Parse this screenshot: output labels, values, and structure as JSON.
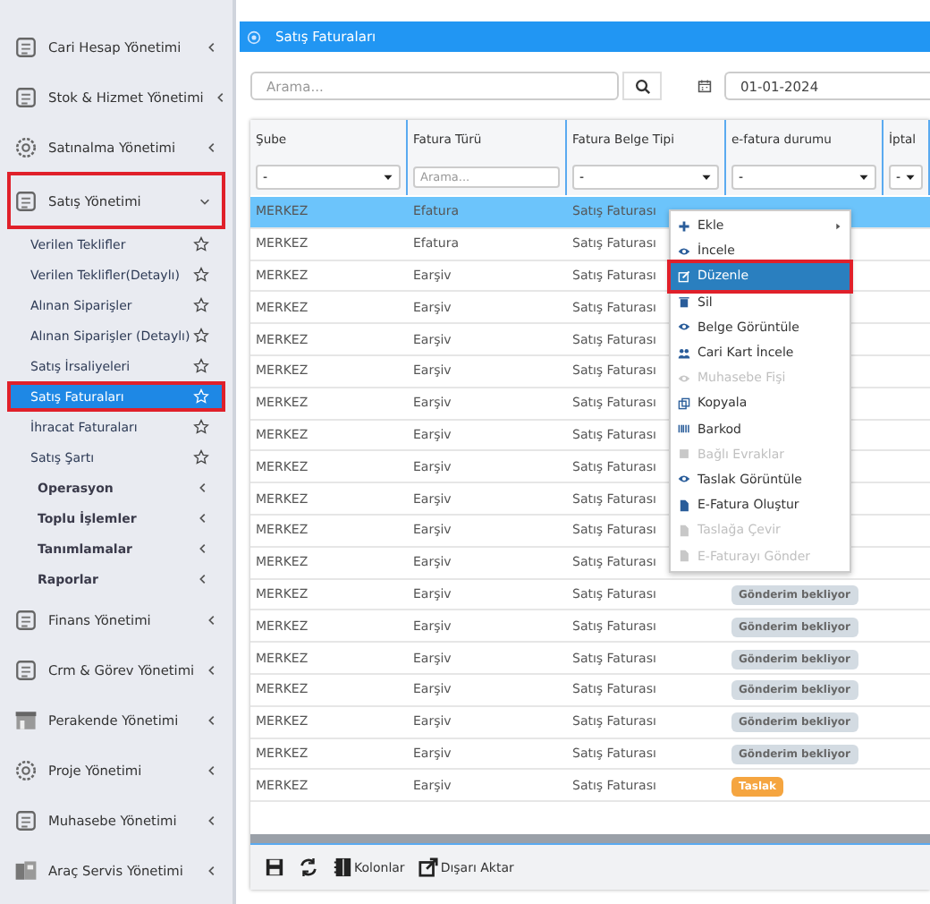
{
  "sidebar": {
    "items": [
      {
        "label": "Cari Hesap Yönetimi",
        "expanded": false,
        "annotated": false
      },
      {
        "label": "Stok & Hizmet Yönetimi",
        "expanded": false,
        "annotated": false
      },
      {
        "label": "Satınalma Yönetimi",
        "expanded": false,
        "annotated": false
      },
      {
        "label": "Satış Yönetimi",
        "expanded": true,
        "annotated": true,
        "children": [
          {
            "label": "Verilen Teklifler",
            "kind": "page",
            "selected": false,
            "annotated": false
          },
          {
            "label": "Verilen Teklifler(Detaylı)",
            "kind": "page",
            "selected": false,
            "annotated": false
          },
          {
            "label": "Alınan Siparişler",
            "kind": "page",
            "selected": false,
            "annotated": false
          },
          {
            "label": "Alınan Siparişler (Detaylı)",
            "kind": "page",
            "selected": false,
            "annotated": false
          },
          {
            "label": "Satış İrsaliyeleri",
            "kind": "page",
            "selected": false,
            "annotated": false
          },
          {
            "label": "Satış Faturaları",
            "kind": "page",
            "selected": true,
            "annotated": true
          },
          {
            "label": "İhracat Faturaları",
            "kind": "page",
            "selected": false,
            "annotated": false
          },
          {
            "label": "Satış Şartı",
            "kind": "page",
            "selected": false,
            "annotated": false
          },
          {
            "label": "Operasyon",
            "kind": "group",
            "selected": false,
            "annotated": false
          },
          {
            "label": "Toplu İşlemler",
            "kind": "group",
            "selected": false,
            "annotated": false
          },
          {
            "label": "Tanımlamalar",
            "kind": "group",
            "selected": false,
            "annotated": false
          },
          {
            "label": "Raporlar",
            "kind": "group",
            "selected": false,
            "annotated": false
          }
        ]
      },
      {
        "label": "Finans Yönetimi",
        "expanded": false,
        "annotated": false
      },
      {
        "label": "Crm & Görev Yönetimi",
        "expanded": false,
        "annotated": false
      },
      {
        "label": "Perakende Yönetimi",
        "expanded": false,
        "annotated": false
      },
      {
        "label": "Proje Yönetimi",
        "expanded": false,
        "annotated": false
      },
      {
        "label": "Muhasebe Yönetimi",
        "expanded": false,
        "annotated": false
      },
      {
        "label": "Araç Servis Yönetimi",
        "expanded": false,
        "annotated": false
      }
    ]
  },
  "panel": {
    "title": "Satış Faturaları"
  },
  "search": {
    "placeholder": "Arama..."
  },
  "date": {
    "value": "01-01-2024"
  },
  "table": {
    "columns": [
      {
        "label": "Şube",
        "kind": "select",
        "filter_value": "-"
      },
      {
        "label": "Fatura Türü",
        "kind": "text",
        "placeholder": "Arama..."
      },
      {
        "label": "Fatura Belge Tipi",
        "kind": "select",
        "filter_value": "-"
      },
      {
        "label": "e-fatura durumu",
        "kind": "select",
        "filter_value": "-"
      },
      {
        "label": "İptal",
        "kind": "select",
        "filter_value": "-"
      }
    ],
    "rows": [
      {
        "cells": [
          "MERKEZ",
          "Efatura",
          "Satış Faturası"
        ],
        "selected": true
      },
      {
        "cells": [
          "MERKEZ",
          "Efatura",
          "Satış Faturası"
        ],
        "selected": false
      },
      {
        "cells": [
          "MERKEZ",
          "Earşiv",
          "Satış Faturası"
        ],
        "selected": false
      },
      {
        "cells": [
          "MERKEZ",
          "Earşiv",
          "Satış Faturası"
        ],
        "selected": false
      },
      {
        "cells": [
          "MERKEZ",
          "Earşiv",
          "Satış Faturası"
        ],
        "selected": false
      },
      {
        "cells": [
          "MERKEZ",
          "Earşiv",
          "Satış Faturası"
        ],
        "selected": false
      },
      {
        "cells": [
          "MERKEZ",
          "Earşiv",
          "Satış Faturası"
        ],
        "selected": false
      },
      {
        "cells": [
          "MERKEZ",
          "Earşiv",
          "Satış Faturası"
        ],
        "selected": false
      },
      {
        "cells": [
          "MERKEZ",
          "Earşiv",
          "Satış Faturası"
        ],
        "selected": false
      },
      {
        "cells": [
          "MERKEZ",
          "Earşiv",
          "Satış Faturası"
        ],
        "selected": false
      },
      {
        "cells": [
          "MERKEZ",
          "Earşiv",
          "Satış Faturası"
        ],
        "selected": false
      },
      {
        "cells": [
          "MERKEZ",
          "Earşiv",
          "Satış Faturası"
        ],
        "selected": false
      },
      {
        "cells": [
          "MERKEZ",
          "Earşiv",
          "Satış Faturası"
        ],
        "status": {
          "label": "Gönderim bekliyor",
          "color": "#d3dbe2"
        },
        "selected": false
      },
      {
        "cells": [
          "MERKEZ",
          "Earşiv",
          "Satış Faturası"
        ],
        "status": {
          "label": "Gönderim bekliyor",
          "color": "#d3dbe2"
        },
        "selected": false
      },
      {
        "cells": [
          "MERKEZ",
          "Earşiv",
          "Satış Faturası"
        ],
        "status": {
          "label": "Gönderim bekliyor",
          "color": "#d3dbe2"
        },
        "selected": false
      },
      {
        "cells": [
          "MERKEZ",
          "Earşiv",
          "Satış Faturası"
        ],
        "status": {
          "label": "Gönderim bekliyor",
          "color": "#d3dbe2"
        },
        "selected": false
      },
      {
        "cells": [
          "MERKEZ",
          "Earşiv",
          "Satış Faturası"
        ],
        "status": {
          "label": "Gönderim bekliyor",
          "color": "#d3dbe2"
        },
        "selected": false
      },
      {
        "cells": [
          "MERKEZ",
          "Earşiv",
          "Satış Faturası"
        ],
        "status": {
          "label": "Gönderim bekliyor",
          "color": "#d3dbe2"
        },
        "selected": false
      },
      {
        "cells": [
          "MERKEZ",
          "Earşiv",
          "Satış Faturası"
        ],
        "status": {
          "label": "Taslak",
          "color": "#f5a540"
        },
        "selected": false
      }
    ]
  },
  "context_menu": {
    "items": [
      {
        "label": "Ekle",
        "disabled": false,
        "selected": false,
        "submenu": true,
        "annotated": false
      },
      {
        "label": "İncele",
        "disabled": false,
        "selected": false,
        "submenu": false,
        "annotated": false
      },
      {
        "label": "Düzenle",
        "disabled": false,
        "selected": true,
        "submenu": false,
        "annotated": true
      },
      {
        "label": "Sil",
        "disabled": false,
        "selected": false,
        "submenu": false,
        "annotated": false
      },
      {
        "label": "Belge Görüntüle",
        "disabled": false,
        "selected": false,
        "submenu": false,
        "annotated": false
      },
      {
        "label": "Cari Kart İncele",
        "disabled": false,
        "selected": false,
        "submenu": false,
        "annotated": false
      },
      {
        "label": "Muhasebe Fişi",
        "disabled": true,
        "selected": false,
        "submenu": false,
        "annotated": false
      },
      {
        "label": "Kopyala",
        "disabled": false,
        "selected": false,
        "submenu": false,
        "annotated": false
      },
      {
        "label": "Barkod",
        "disabled": false,
        "selected": false,
        "submenu": false,
        "annotated": false
      },
      {
        "label": "Bağlı Evraklar",
        "disabled": true,
        "selected": false,
        "submenu": false,
        "annotated": false
      },
      {
        "label": "Taslak Görüntüle",
        "disabled": false,
        "selected": false,
        "submenu": false,
        "annotated": false
      },
      {
        "label": "E-Fatura Oluştur",
        "disabled": false,
        "selected": false,
        "submenu": false,
        "annotated": false
      },
      {
        "label": "Taslağa Çevir",
        "disabled": true,
        "selected": false,
        "submenu": false,
        "annotated": false
      },
      {
        "label": "E-Faturayı Gönder",
        "disabled": true,
        "selected": false,
        "submenu": false,
        "annotated": false
      }
    ]
  },
  "footer": {
    "buttons": [
      {
        "label": "Kolonlar"
      },
      {
        "label": "Dışarı Aktar"
      }
    ]
  }
}
